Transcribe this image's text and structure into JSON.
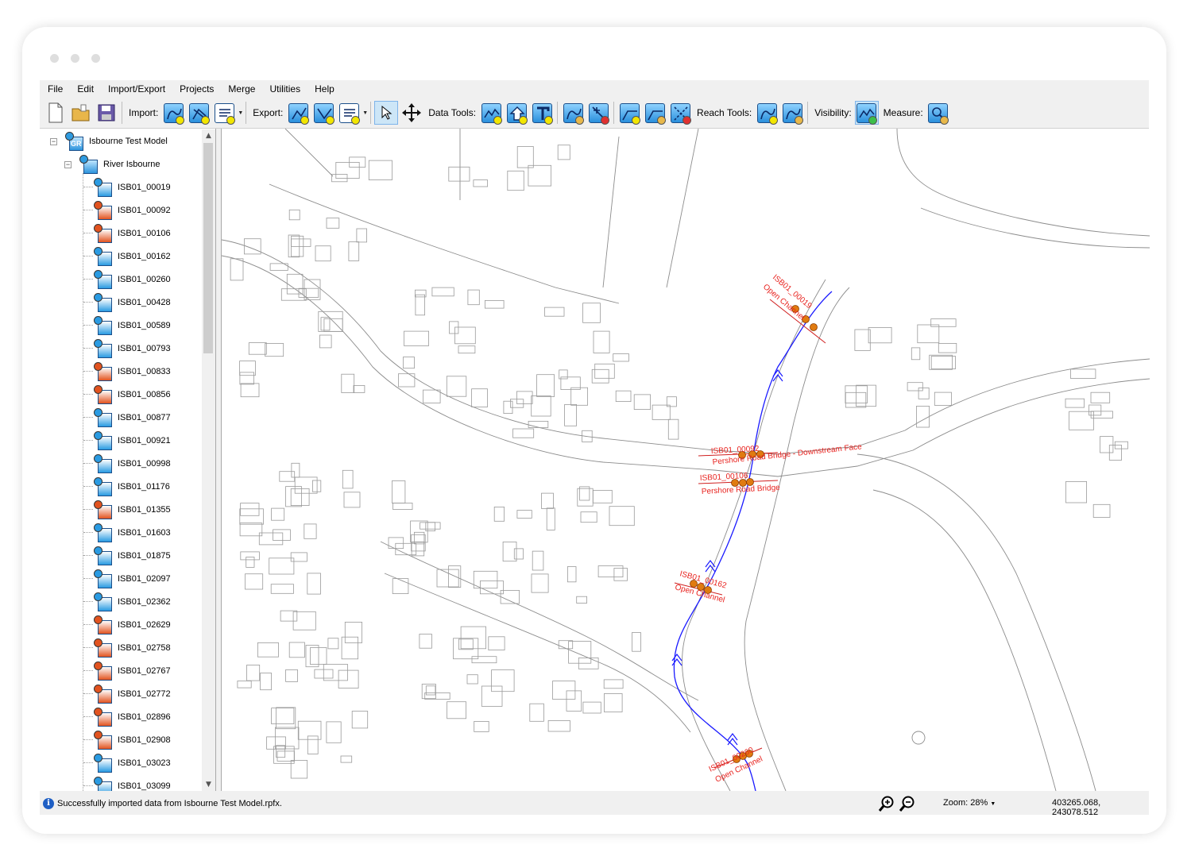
{
  "menu": [
    "File",
    "Edit",
    "Import/Export",
    "Projects",
    "Merge",
    "Utilities",
    "Help"
  ],
  "toolbar": {
    "import_label": "Import:",
    "export_label": "Export:",
    "data_tools_label": "Data Tools:",
    "reach_tools_label": "Reach Tools:",
    "visibility_label": "Visibility:",
    "measure_label": "Measure:"
  },
  "tree": {
    "model_badge": "GR",
    "model": "Isbourne Test Model",
    "river": "River Isbourne",
    "nodes": [
      {
        "label": "ISB01_00019",
        "type": "blue"
      },
      {
        "label": "ISB01_00092",
        "type": "red"
      },
      {
        "label": "ISB01_00106",
        "type": "red"
      },
      {
        "label": "ISB01_00162",
        "type": "blue"
      },
      {
        "label": "ISB01_00260",
        "type": "blue"
      },
      {
        "label": "ISB01_00428",
        "type": "blue"
      },
      {
        "label": "ISB01_00589",
        "type": "blue"
      },
      {
        "label": "ISB01_00793",
        "type": "blue"
      },
      {
        "label": "ISB01_00833",
        "type": "red"
      },
      {
        "label": "ISB01_00856",
        "type": "red"
      },
      {
        "label": "ISB01_00877",
        "type": "blue"
      },
      {
        "label": "ISB01_00921",
        "type": "blue"
      },
      {
        "label": "ISB01_00998",
        "type": "blue"
      },
      {
        "label": "ISB01_01176",
        "type": "blue"
      },
      {
        "label": "ISB01_01355",
        "type": "red"
      },
      {
        "label": "ISB01_01603",
        "type": "blue"
      },
      {
        "label": "ISB01_01875",
        "type": "blue"
      },
      {
        "label": "ISB01_02097",
        "type": "blue"
      },
      {
        "label": "ISB01_02362",
        "type": "blue"
      },
      {
        "label": "ISB01_02629",
        "type": "red"
      },
      {
        "label": "ISB01_02758",
        "type": "red"
      },
      {
        "label": "ISB01_02767",
        "type": "red"
      },
      {
        "label": "ISB01_02772",
        "type": "red"
      },
      {
        "label": "ISB01_02896",
        "type": "red"
      },
      {
        "label": "ISB01_02908",
        "type": "red"
      },
      {
        "label": "ISB01_03023",
        "type": "blue"
      },
      {
        "label": "ISB01_03099",
        "type": "blue"
      }
    ]
  },
  "map_labels": {
    "n19_id": "ISB01_00019",
    "n19_type": "Open Channel",
    "n92_id": "ISB01_00092",
    "n92_type": "Pershore Road Bridge - Downstream Face",
    "n106_id": "ISB01_00106",
    "n106_type": "Pershore Road Bridge",
    "n162_id": "ISB01_00162",
    "n162_type": "Open Channel",
    "n260_id": "ISB01_00260",
    "n260_type": "Open Channel"
  },
  "colors": {
    "river": "#1a1aff",
    "node_label": "#e8231f",
    "node_dot": "#e07b10",
    "blue_node": "#2a9be2",
    "red_node": "#e2531f"
  },
  "status": {
    "message": "Successfully imported data from Isbourne Test Model.rpfx.",
    "zoom": "Zoom: 28%",
    "coords": "403265.068, 243078.512"
  }
}
